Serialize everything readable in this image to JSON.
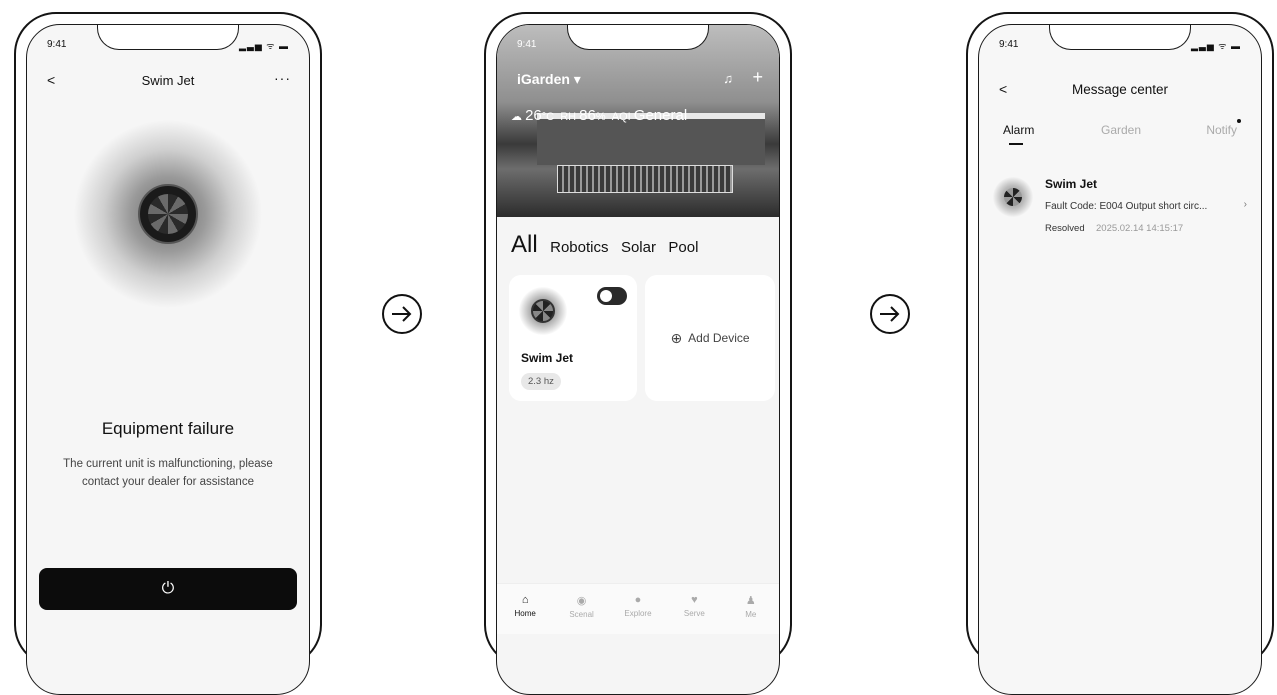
{
  "status_time": "9:41",
  "phone1": {
    "title": "Swim Jet",
    "back": "<",
    "more": "···",
    "fail_title": "Equipment failure",
    "fail_desc": "The current unit is malfunctioning, please contact your dealer for assistance",
    "power_icon": "⏻"
  },
  "phone2": {
    "brand": "iGarden ▾",
    "weather_temp": "26",
    "weather_unit": "°C",
    "weather_rh_label": "RH",
    "weather_rh": "86",
    "weather_rh_unit": "%",
    "weather_aqi_label": "AQI",
    "weather_aqi": "General",
    "categories": [
      "All",
      "Robotics",
      "Solar",
      "Pool"
    ],
    "device_name": "Swim Jet",
    "device_value": "2.3 hz",
    "add_device": "Add Device",
    "tabs": [
      "Home",
      "Scenal",
      "Explore",
      "Serve",
      "Me"
    ]
  },
  "phone3": {
    "back": "<",
    "title": "Message center",
    "tabs": [
      "Alarm",
      "Garden",
      "Notify"
    ],
    "msg_title": "Swim Jet",
    "msg_desc": "Fault Code: E004 Output short circ...",
    "msg_status": "Resolved",
    "msg_date": "2025.02.14 14:15:17"
  }
}
